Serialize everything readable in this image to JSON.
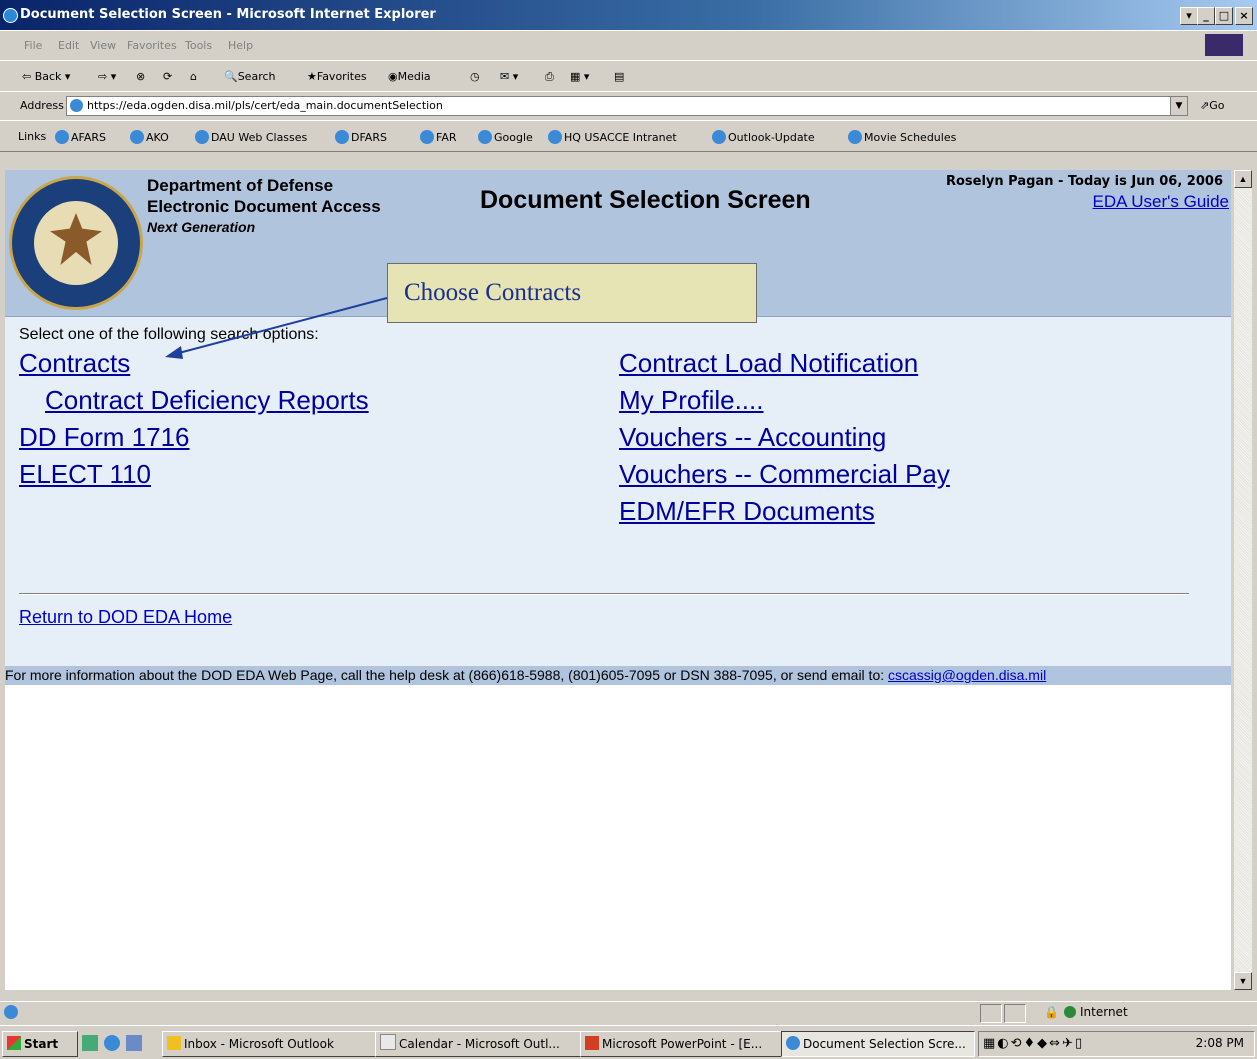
{
  "window": {
    "title": "Document Selection Screen - Microsoft Internet Explorer"
  },
  "menubar": [
    "File",
    "Edit",
    "View",
    "Favorites",
    "Tools",
    "Help"
  ],
  "toolbar": {
    "back": "Back",
    "search": "Search",
    "favorites": "Favorites",
    "media": "Media"
  },
  "address": {
    "label": "Address",
    "url": "https://eda.ogden.disa.mil/pls/cert/eda_main.documentSelection",
    "go": "Go"
  },
  "links": {
    "label": "Links",
    "items": [
      "AFARS",
      "AKO",
      "DAU Web Classes",
      "DFARS",
      "FAR",
      "Google",
      "HQ USACCE Intranet",
      "Outlook-Update",
      "Movie Schedules"
    ]
  },
  "header": {
    "org": "Department of Defense",
    "system": "Electronic Document Access",
    "tag": "Next Generation",
    "title": "Document Selection Screen",
    "user": "Roselyn Pagan - Today is Jun 06, 2006",
    "guide": "EDA User's Guide"
  },
  "callout": "Choose Contracts",
  "body": {
    "prompt": "Select one of the following search options:",
    "left_options": [
      "Contracts",
      "Contract Deficiency Reports",
      "DD Form 1716",
      "ELECT 110"
    ],
    "right_options": [
      "Contract Load Notification",
      "My Profile....",
      "Vouchers -- Accounting",
      "Vouchers -- Commercial Pay",
      "EDM/EFR Documents"
    ],
    "home_link": "Return to DOD EDA Home"
  },
  "footer": {
    "text": "For more information about the DOD EDA Web Page, call the help desk at (866)618-5988, (801)605-7095 or DSN 388-7095, or send email to: ",
    "email": "cscassig@ogden.disa.mil"
  },
  "status": {
    "zone": "Internet"
  },
  "taskbar": {
    "start": "Start",
    "tasks": [
      "Inbox - Microsoft Outlook",
      "Calendar - Microsoft Outl...",
      "Microsoft PowerPoint - [E...",
      "Document Selection Scre..."
    ],
    "clock": "2:08 PM"
  },
  "colors": {
    "header_bg": "#b0c4de",
    "body_bg": "#e6eff7",
    "link": "#0000a0",
    "callout_bg": "#e6e3b4"
  }
}
